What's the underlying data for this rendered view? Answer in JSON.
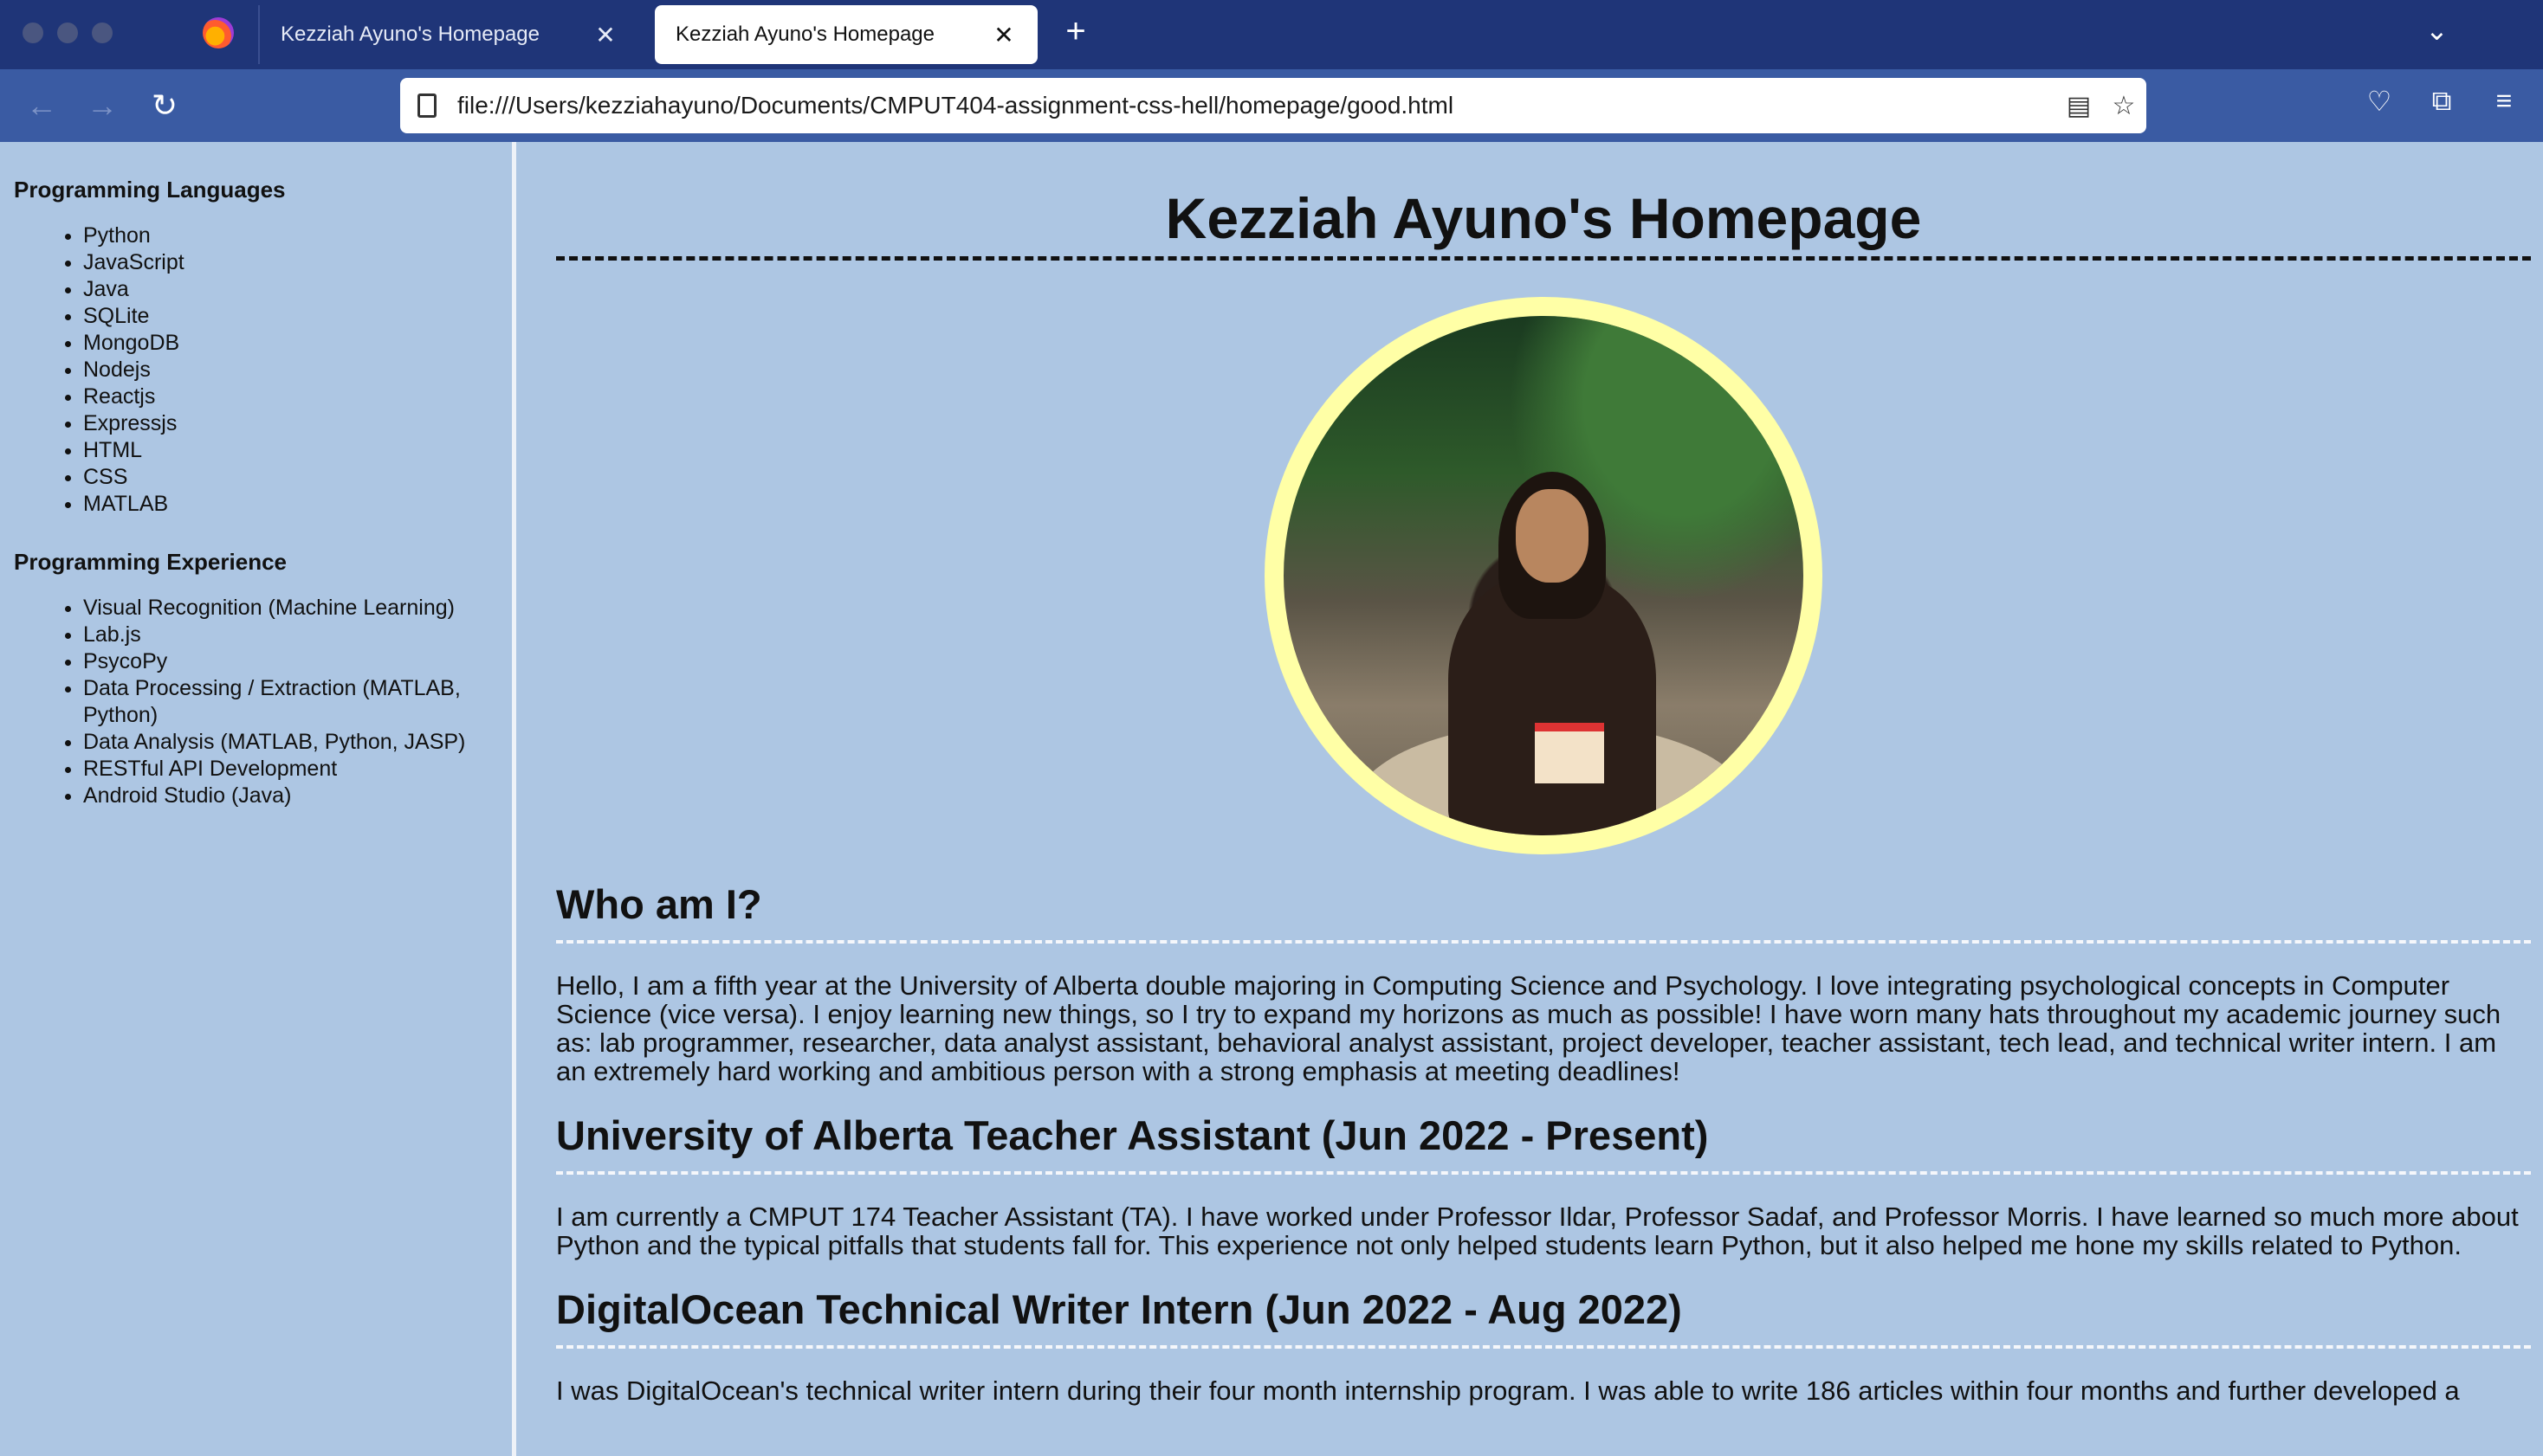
{
  "browser": {
    "tabs": [
      {
        "label": "Kezziah Ayuno's Homepage",
        "active": false
      },
      {
        "label": "Kezziah Ayuno's Homepage",
        "active": true
      }
    ],
    "url": "file:///Users/kezziahayuno/Documents/CMPUT404-assignment-css-hell/homepage/good.html"
  },
  "sidebar": {
    "languages_heading": "Programming Languages",
    "languages": [
      "Python",
      "JavaScript",
      "Java",
      "SQLite",
      "MongoDB",
      "Nodejs",
      "Reactjs",
      "Expressjs",
      "HTML",
      "CSS",
      "MATLAB"
    ],
    "experience_heading": "Programming Experience",
    "experience": [
      "Visual Recognition (Machine Learning)",
      "Lab.js",
      "PsycoPy",
      "Data Processing / Extraction (MATLAB, Python)",
      "Data Analysis (MATLAB, Python, JASP)",
      "RESTful API Development",
      "Android Studio (Java)"
    ]
  },
  "main": {
    "title": "Kezziah Ayuno's Homepage",
    "sections": [
      {
        "heading": "Who am I?",
        "text": "Hello, I am a fifth year at the University of Alberta double majoring in Computing Science and Psychology. I love integrating psychological concepts in Computer Science (vice versa). I enjoy learning new things, so I try to expand my horizons as much as possible! I have worn many hats throughout my academic journey such as: lab programmer, researcher, data analyst assistant, behavioral analyst assistant, project developer, teacher assistant, tech lead, and technical writer intern. I am an extremely hard working and ambitious person with a strong emphasis at meeting deadlines!"
      },
      {
        "heading": "University of Alberta Teacher Assistant (Jun 2022 - Present)",
        "text": "I am currently a CMPUT 174 Teacher Assistant (TA). I have worked under Professor Ildar, Professor Sadaf, and Professor Morris. I have learned so much more about Python and the typical pitfalls that students fall for. This experience not only helped students learn Python, but it also helped me hone my skills related to Python."
      },
      {
        "heading": "DigitalOcean Technical Writer Intern (Jun 2022 - Aug 2022)",
        "text": "I was DigitalOcean's technical writer intern during their four month internship program. I was able to write 186 articles within four months and further developed a"
      }
    ]
  },
  "colors": {
    "page_bg": "#adc6e3",
    "tabbar_bg": "#1f3578",
    "navbar_bg": "#3a5ba3",
    "photo_border": "#ffffa6"
  }
}
